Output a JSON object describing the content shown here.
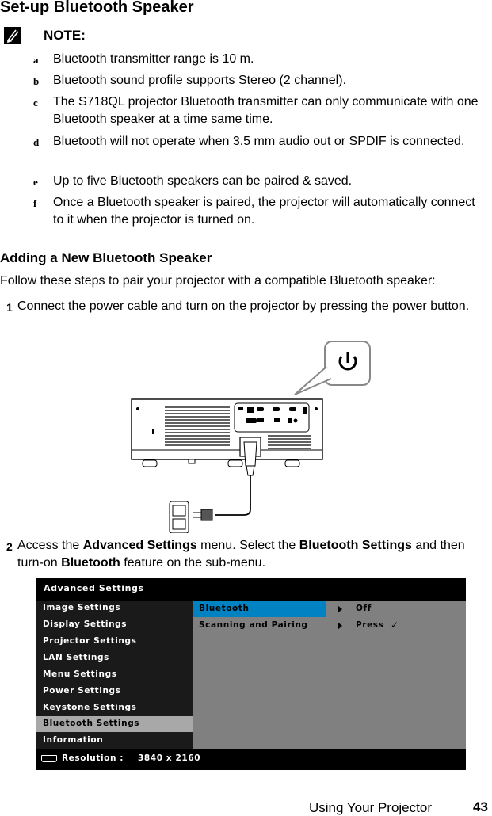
{
  "page": {
    "title": "Set-up Bluetooth Speaker",
    "note": {
      "label": "NOTE:",
      "items": [
        {
          "letter": "a",
          "text": "Bluetooth transmitter range is 10 m."
        },
        {
          "letter": "b",
          "text": "Bluetooth sound profile supports Stereo (2 channel)."
        },
        {
          "letter": "c",
          "text": "The S718QL projector Bluetooth transmitter can only communicate with one Bluetooth speaker at a time same time."
        },
        {
          "letter": "d",
          "text": "Bluetooth will not operate when 3.5 mm audio out or SPDIF is connected."
        },
        {
          "letter": "e",
          "text": "Up to five Bluetooth speakers can be paired & saved."
        },
        {
          "letter": "f",
          "text": "Once a Bluetooth speaker is paired, the projector will automatically connect to it when the projector is turned on."
        }
      ]
    },
    "section_title": "Adding a New Bluetooth Speaker",
    "intro": "Follow these steps to pair your projector with a compatible Bluetooth speaker:",
    "steps": [
      {
        "num": "1",
        "text": "Connect the power cable and turn on the projector by pressing the power button."
      },
      {
        "num": "2",
        "parts": {
          "p1": "Access the ",
          "b1": "Advanced Settings",
          "p2": " menu. Select the ",
          "b2": "Bluetooth Settings",
          "p3": " and then turn-on ",
          "b3": "Bluetooth",
          "p4": " feature on the sub-menu."
        }
      }
    ],
    "illustration": {
      "description": "Projector rear panel with power cable connected to wall outlet",
      "callout_icon": "power-icon"
    },
    "footer": {
      "section": "Using Your Projector",
      "page_number": "43"
    }
  },
  "osd_menu": {
    "title": "Advanced Settings",
    "items": [
      {
        "label": "Image Settings",
        "selected": false
      },
      {
        "label": "Display Settings",
        "selected": false
      },
      {
        "label": "Projector Settings",
        "selected": false
      },
      {
        "label": "LAN Settings",
        "selected": false
      },
      {
        "label": "Menu Settings",
        "selected": false
      },
      {
        "label": "Power Settings",
        "selected": false
      },
      {
        "label": "Keystone Settings",
        "selected": false
      },
      {
        "label": "Bluetooth Settings",
        "selected": true
      },
      {
        "label": "Information",
        "selected": false
      }
    ],
    "submenu": [
      {
        "label": "Bluetooth",
        "value": "Off",
        "highlighted": true
      },
      {
        "label": "Scanning and Pairing",
        "value": "Press",
        "check": "✓",
        "highlighted": false
      }
    ],
    "status": {
      "icon": "hdmi-icon",
      "label": "Resolution :",
      "value": "3840 x 2160"
    },
    "colors": {
      "highlight": "#0082c3",
      "selected_item": "#a8a8a8",
      "panel": "#808080",
      "background": "#000000"
    }
  }
}
